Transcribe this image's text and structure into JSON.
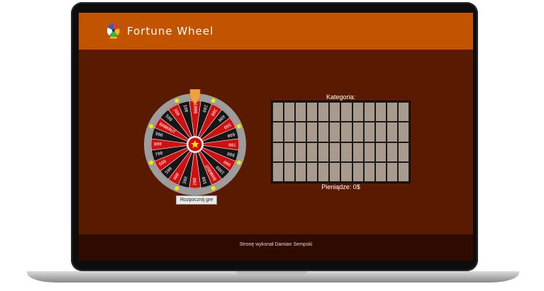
{
  "header": {
    "title": "Fortune Wheel",
    "logo_icon": "fortune-wheel-logo-icon"
  },
  "wheel": {
    "segment_colors": [
      "#d10f0f",
      "#161616"
    ],
    "rim_color": "#9d9d9d",
    "light_color": "#f2e800",
    "pointer_color": "#f0a040",
    "center_icon": "star-icon",
    "segment_labels": [
      "1000",
      "200",
      "300",
      "400",
      "500",
      "600",
      "700",
      "800",
      "900",
      "1000",
      "BANKRUT",
      "100",
      "200",
      "300",
      "400",
      "500",
      "600",
      "700",
      "800",
      "900",
      "BANKRUT",
      "500",
      "300",
      "100"
    ]
  },
  "controls": {
    "start_label": "Rozpocznij gre"
  },
  "board": {
    "category_label": "Kategoria:",
    "money_label": "Pieniądze: 0$",
    "columns": 12,
    "rows": 4
  },
  "footer": {
    "credit": "Stronę wykonał Damian Sempski"
  },
  "colors": {
    "header_bg": "#c25400",
    "main_bg": "#5a1a00",
    "footer_bg": "#2e0a00",
    "cell": "#a89a8c"
  }
}
